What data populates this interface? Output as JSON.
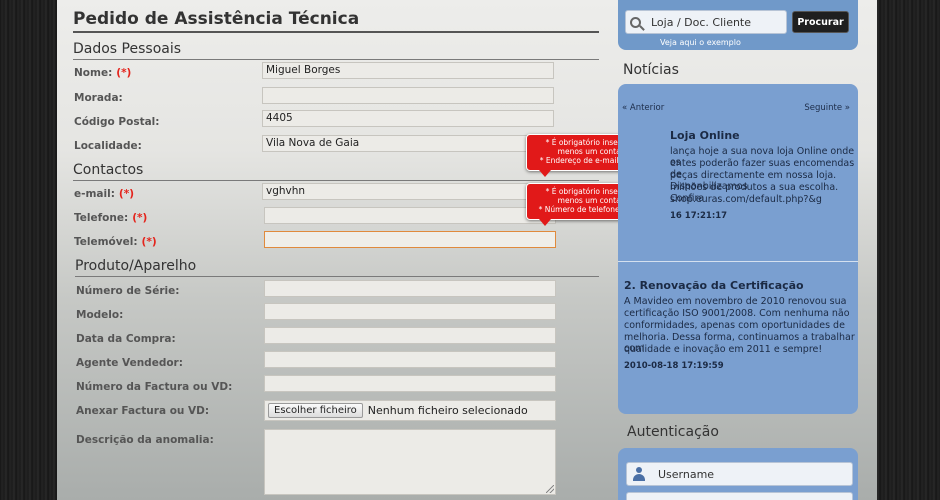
{
  "form": {
    "title": "Pedido de Assistência Técnica",
    "required_mark": "(*)",
    "sections": {
      "personal": "Dados Pessoais",
      "contacts": "Contactos",
      "product": "Produto/Aparelho"
    },
    "personal": {
      "name_label": "Nome:",
      "name_value": "Miguel Borges",
      "address_label": "Morada:",
      "address_value": "",
      "postal_label": "Código Postal:",
      "postal_value": "4405",
      "locality_label": "Localidade:",
      "locality_value": "Vila Nova de Gaia"
    },
    "contacts": {
      "email_label": "e-mail:",
      "email_value": "vghvhn",
      "phone_label": "Telefone:",
      "phone_value": "",
      "mobile_label": "Telemóvel:",
      "mobile_value": ""
    },
    "product": {
      "serial_label": "Número de Série:",
      "model_label": "Modelo:",
      "purchase_date_label": "Data da Compra:",
      "seller_label": "Agente Vendedor:",
      "invoice_number_label": "Número da Factura ou VD:",
      "attach_label": "Anexar Factura ou VD:",
      "file_button": "Escolher ficheiro",
      "file_status": "Nenhum ficheiro selecionado",
      "description_label": "Descrição da anomalia:"
    },
    "errors": {
      "email_tip_line1": "* É obrigatório inserir pelo",
      "email_tip_line2": "menos um contacto",
      "email_tip_line3": "* Endereço de e-mail inválido",
      "phone_tip_line1": "* É obrigatório inserir pelo",
      "phone_tip_line2": "menos um contacto",
      "phone_tip_line3": "* Número de telefone inválido"
    }
  },
  "sidebar": {
    "search": {
      "value": "Loja  / Doc. Cliente",
      "button": "Procurar",
      "hint": "Veja aqui o exemplo"
    },
    "news": {
      "heading": "Notícias",
      "prev": "« Anterior",
      "next": "Seguinte »",
      "item1": {
        "title": "Loja Online",
        "line1": "lança hoje a sua nova loja Online onde os",
        "line2": "entes poderão fazer suas encomendas de",
        "line3": "peças directamente em nossa loja. Disponbilizamos",
        "line4": "milhões de produtos a sua escolha. Confira",
        "line5": "shop.euras.com/default.php?&g",
        "date": "16 17:21:17"
      },
      "item2": {
        "title": "2. Renovação da Certificação",
        "line1": "A Mavideo em novembro de 2010 renovou sua",
        "line2": "certificação ISO 9001/2008. Com nenhuma não",
        "line3": "conformidades, apenas com oportunidades de",
        "line4": "melhoria. Dessa forma, continuamos a trabalhar com",
        "line5": "qualidade e inovação em 2011 e sempre!",
        "date": "2010-08-18 17:19:59"
      }
    },
    "auth": {
      "heading": "Autenticação",
      "username_placeholder": "Username"
    }
  },
  "colors": {
    "accent_blue": "#7a9fd0",
    "error_red": "#e11919",
    "required_red": "#e4241c",
    "focus_orange": "#e08a3c"
  }
}
